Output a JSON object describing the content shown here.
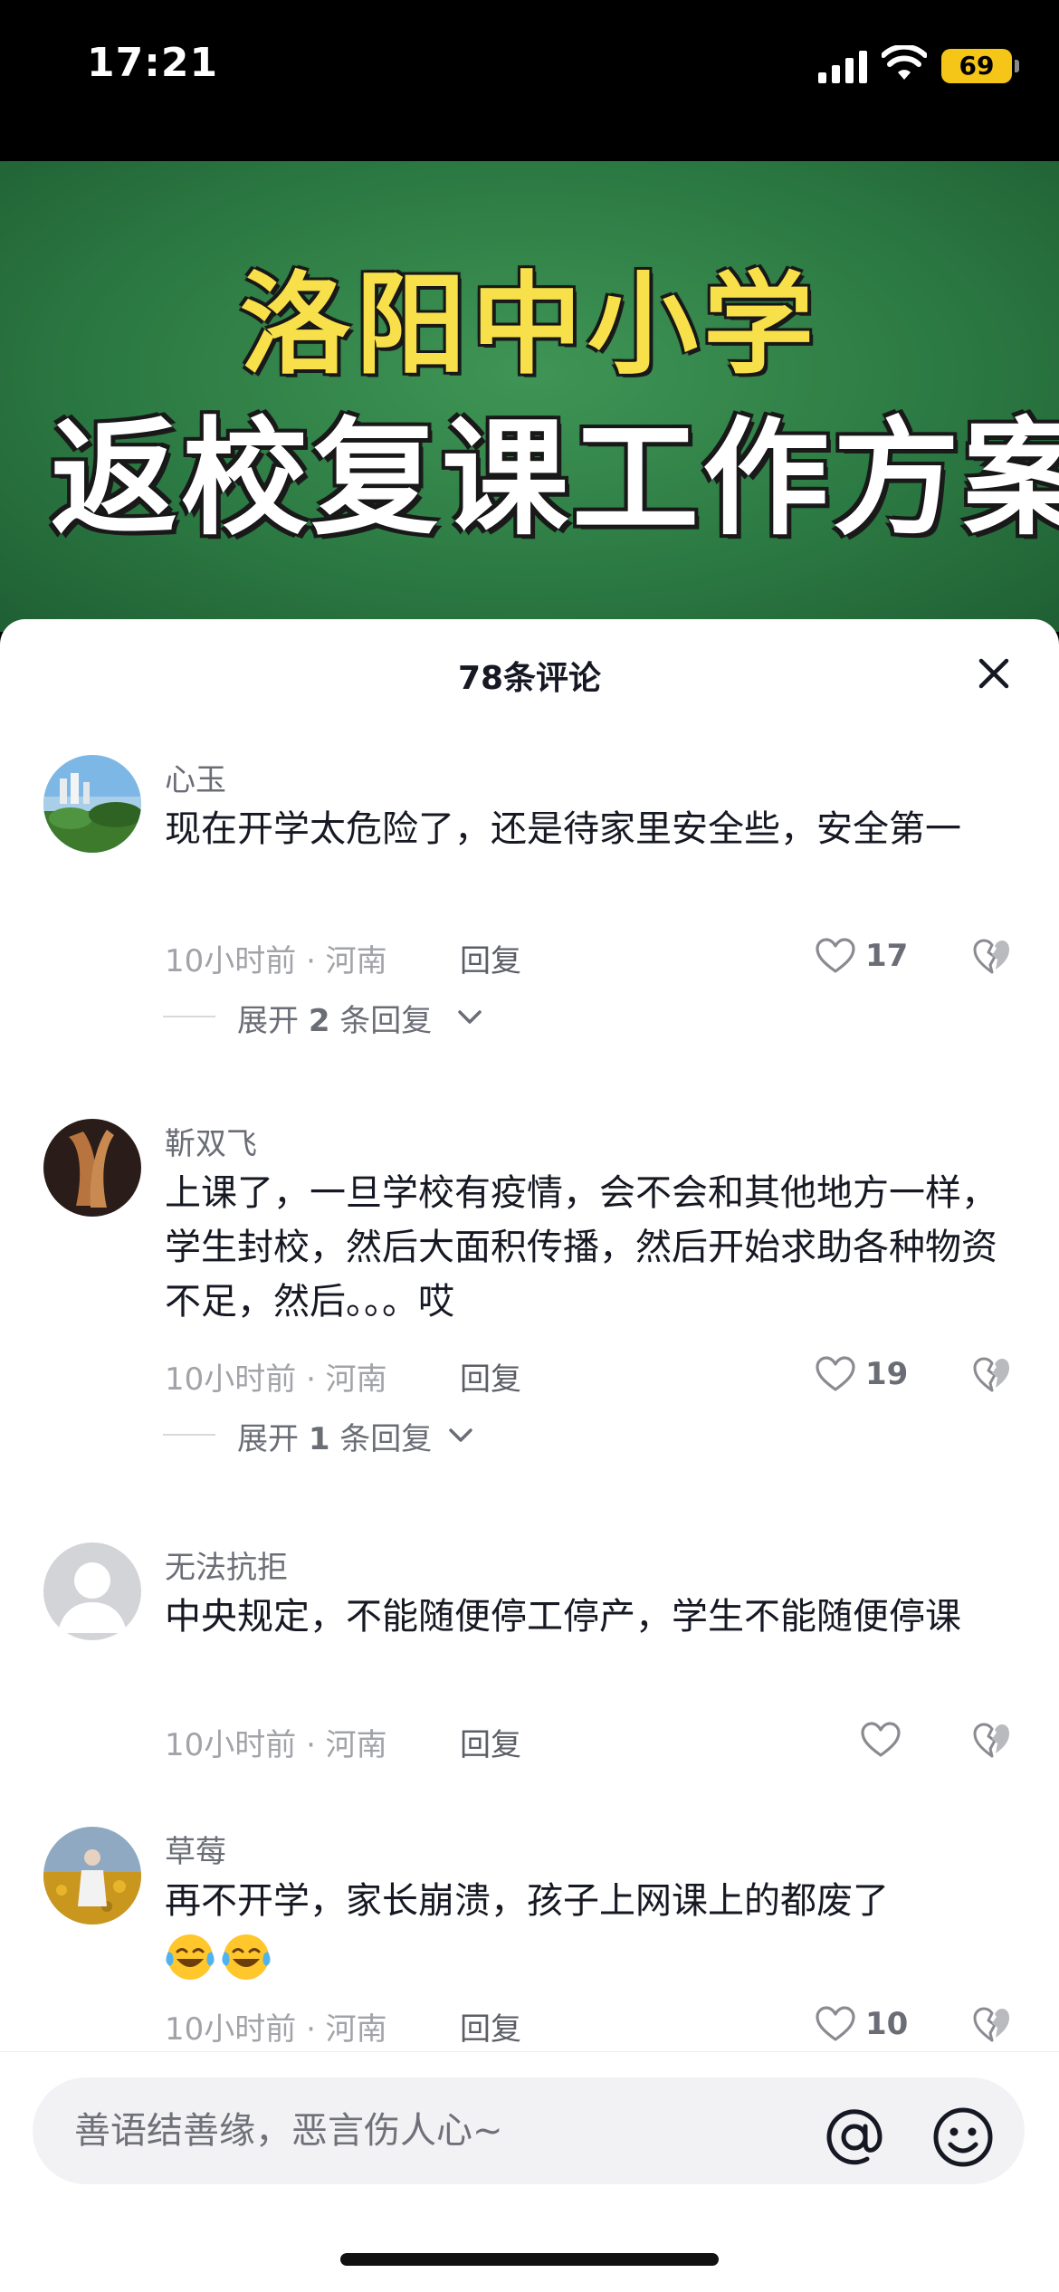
{
  "status_bar": {
    "time": "17:21",
    "battery": "69"
  },
  "banner": {
    "line1": "洛阳中小学",
    "line2": "返校复课工作方案"
  },
  "sheet": {
    "title": "78条评论"
  },
  "comments": [
    {
      "user": "心玉",
      "text": "现在开学太危险了，还是待家里安全些，安全第一",
      "meta": "10小时前 · 河南",
      "reply": "回复",
      "likes": "17",
      "expand_prefix": "展开",
      "expand_count": "2",
      "expand_suffix": "条回复"
    },
    {
      "user": "靳双飞",
      "text": "上课了，一旦学校有疫情，会不会和其他地方一样，学生封校，然后大面积传播，然后开始求助各种物资不足，然后。。。哎",
      "meta": "10小时前 · 河南",
      "reply": "回复",
      "likes": "19",
      "expand_prefix": "展开",
      "expand_count": "1",
      "expand_suffix": "条回复"
    },
    {
      "user": "无法抗拒",
      "text": "中央规定，不能随便停工停产，学生不能随便停课",
      "meta": "10小时前 · 河南",
      "reply": "回复",
      "likes": ""
    },
    {
      "user": "草莓",
      "text": "再不开学，家长崩溃，孩子上网课上的都废了",
      "meta": "10小时前 · 河南",
      "reply": "回复",
      "likes": "10"
    }
  ],
  "input": {
    "placeholder": "善语结善缘，恶言伤人心~"
  },
  "icons": {
    "like": "heart-outline-icon",
    "dislike": "broken-heart-icon",
    "close": "close-icon",
    "at": "at-sign-icon",
    "emoji": "smiley-icon",
    "laugh": "laughing-crying-emoji-icon"
  },
  "colors": {
    "banner_green": "#2c7a43",
    "banner_yellow": "#f7e04a",
    "battery": "#f5c518"
  }
}
